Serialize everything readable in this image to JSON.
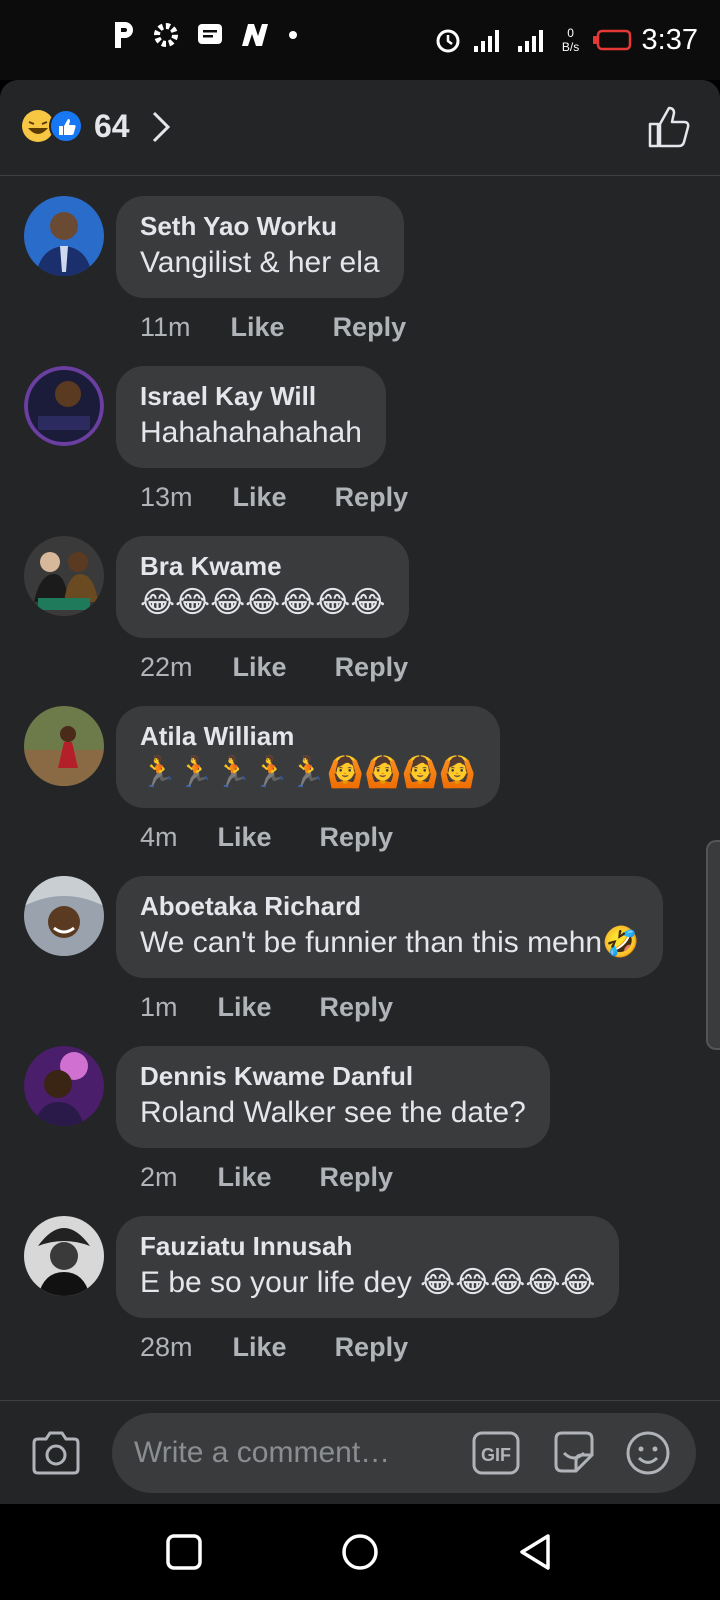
{
  "status_bar": {
    "time": "3:37",
    "net_speed": "0 B/s",
    "left_icons": [
      "p-app-icon",
      "gear-icon",
      "message-icon",
      "n-app-icon",
      "dot-icon"
    ],
    "right_icons": [
      "alarm-icon",
      "signal-icon",
      "signal-icon",
      "battery-icon"
    ]
  },
  "reactions": {
    "count": "64",
    "icons": [
      "haha-icon",
      "like-icon"
    ]
  },
  "comments": [
    {
      "name": "Seth Yao Worku",
      "text": "Vangilist & her ela",
      "time": "11m",
      "like": "Like",
      "reply": "Reply"
    },
    {
      "name": "Israel Kay Will",
      "text": "Hahahahahahah",
      "time": "13m",
      "like": "Like",
      "reply": "Reply"
    },
    {
      "name": "Bra Kwame",
      "text": "😂😂😂😂😂😂😂",
      "time": "22m",
      "like": "Like",
      "reply": "Reply"
    },
    {
      "name": "Atila William",
      "text": "🏃🏃🏃🏃🏃🙆🙆🙆🙆",
      "time": "4m",
      "like": "Like",
      "reply": "Reply"
    },
    {
      "name": "Aboetaka Richard",
      "text": "We can't be funnier than this mehn🤣",
      "time": "1m",
      "like": "Like",
      "reply": "Reply"
    },
    {
      "name": "Dennis Kwame Danful",
      "text": "Roland Walker see the date?",
      "time": "2m",
      "like": "Like",
      "reply": "Reply"
    },
    {
      "name": "Fauziatu Innusah",
      "text": "E be so your life dey 😂😂😂😂😂",
      "time": "28m",
      "like": "Like",
      "reply": "Reply"
    }
  ],
  "composer": {
    "placeholder": "Write a comment…",
    "gif_label": "GIF"
  },
  "colors": {
    "sheet_bg": "#242526",
    "bubble_bg": "#3a3b3c",
    "like_blue": "#1877f2",
    "haha_yellow": "#f7c744"
  }
}
